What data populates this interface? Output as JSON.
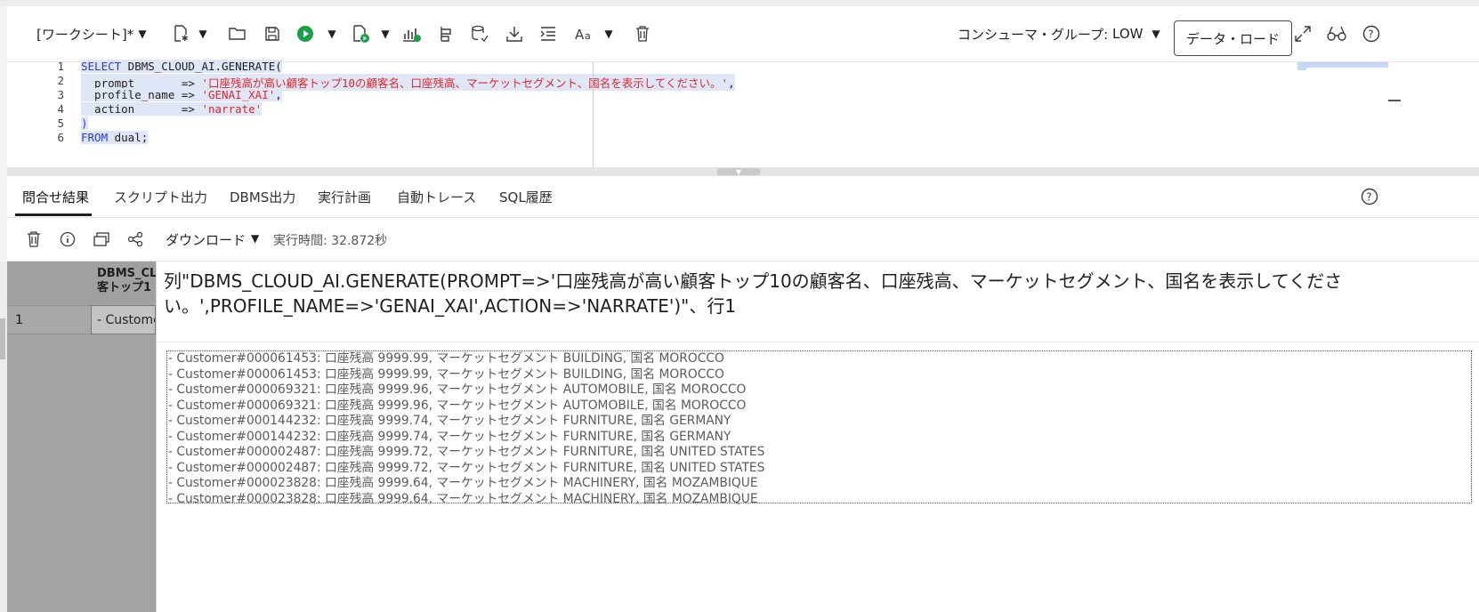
{
  "toolbar": {
    "worksheet_label": "[ワークシート]*",
    "consumer_group_label": "コンシューマ・グループ:",
    "consumer_group_value": "LOW",
    "data_load_label": "データ・ロード",
    "icons": [
      "new-sql-icon",
      "open-icon",
      "save-icon",
      "run-icon",
      "run-script-icon",
      "explain-plan-icon",
      "autotrace-icon",
      "sql-tuning-icon",
      "download-icon",
      "format-icon",
      "font-case-icon",
      "clear-icon",
      "expand-icon",
      "find-icon",
      "help-icon"
    ]
  },
  "editor": {
    "line_numbers": [
      "1",
      "2",
      "3",
      "4",
      "5",
      "6"
    ],
    "lines": {
      "l1_kw": "SELECT",
      "l1_rest": " DBMS_CLOUD_AI.GENERATE(",
      "l2_param": "  prompt       => ",
      "l2_str": "'口座残高が高い顧客トップ10の顧客名、口座残高、マーケットセグメント、国名を表示してください。'",
      "l2_tail": ",",
      "l3_param": "  profile_name => ",
      "l3_str": "'GENAI_XAI'",
      "l3_tail": ",",
      "l4_param": "  action       => ",
      "l4_str": "'narrate'",
      "l5": ")",
      "l6_kw": "FROM",
      "l6_rest": " dual;"
    }
  },
  "tabs": [
    "問合せ結果",
    "スクリプト出力",
    "DBMS出力",
    "実行計画",
    "自動トレース",
    "SQL履歴"
  ],
  "results_toolbar": {
    "download_label": "ダウンロード",
    "exec_time": "実行時間: 32.872秒"
  },
  "grid": {
    "col_header_line1": "DBMS_CL",
    "col_header_line2": "客トップ1",
    "row_number": "1",
    "row_cell": "- Custome"
  },
  "popup": {
    "title": "列\"DBMS_CLOUD_AI.GENERATE(PROMPT=>'口座残高が高い顧客トップ10の顧客名、口座残高、マーケットセグメント、国名を表示してください。',PROFILE_NAME=>'GENAI_XAI',ACTION=>'NARRATE')\"、行1",
    "lines": [
      "- Customer#000061453: 口座残高 9999.99, マーケットセグメント BUILDING, 国名 MOROCCO",
      "- Customer#000061453: 口座残高 9999.99, マーケットセグメント BUILDING, 国名 MOROCCO",
      "- Customer#000069321: 口座残高 9999.96, マーケットセグメント AUTOMOBILE, 国名 MOROCCO",
      "- Customer#000069321: 口座残高 9999.96, マーケットセグメント AUTOMOBILE, 国名 MOROCCO",
      "- Customer#000144232: 口座残高 9999.74, マーケットセグメント FURNITURE, 国名 GERMANY",
      "- Customer#000144232: 口座残高 9999.74, マーケットセグメント FURNITURE, 国名 GERMANY",
      "- Customer#000002487: 口座残高 9999.72, マーケットセグメント FURNITURE, 国名 UNITED STATES",
      "- Customer#000002487: 口座残高 9999.72, マーケットセグメント FURNITURE, 国名 UNITED STATES",
      "- Customer#000023828: 口座残高 9999.64, マーケットセグメント MACHINERY, 国名 MOZAMBIQUE",
      "- Customer#000023828: 口座残高 9999.64, マーケットセグメント MACHINERY, 国名 MOZAMBIQUE"
    ]
  },
  "colors": {
    "keyword": "#2a3bd6",
    "string": "#e0262a",
    "run_green": "#1aa04a"
  }
}
